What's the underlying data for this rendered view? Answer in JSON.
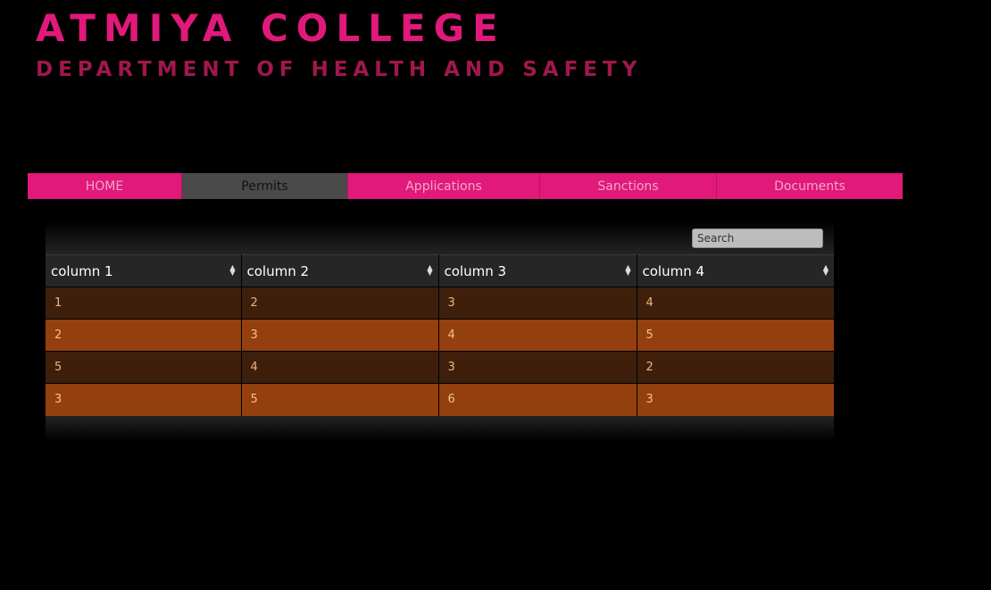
{
  "header": {
    "college": "ATMIYA COLLEGE",
    "department": "DEPARTMENT OF HEALTH AND SAFETY"
  },
  "nav": {
    "items": [
      {
        "label": "HOME"
      },
      {
        "label": "Permits",
        "active": true
      },
      {
        "label": "Applications"
      },
      {
        "label": "Sanctions"
      },
      {
        "label": "Documents"
      }
    ]
  },
  "table": {
    "search_placeholder": "Search",
    "columns": [
      "column 1",
      "column 2",
      "column 3",
      "column 4"
    ],
    "rows": [
      [
        "1",
        "2",
        "3",
        "4"
      ],
      [
        "2",
        "3",
        "4",
        "5"
      ],
      [
        "5",
        "4",
        "3",
        "2"
      ],
      [
        "3",
        "5",
        "6",
        "3"
      ]
    ]
  },
  "colors": {
    "accent": "#e0197a",
    "secondary": "#a0174e",
    "row_dark": "#3d1f0c",
    "row_light": "#933f0e"
  }
}
